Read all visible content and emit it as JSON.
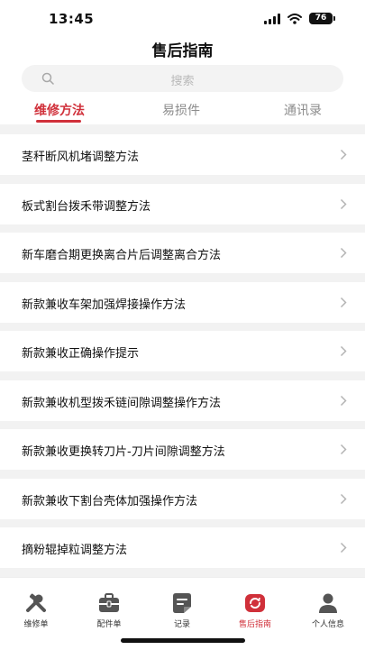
{
  "status": {
    "time": "13:45",
    "battery": "76"
  },
  "page_title": "售后指南",
  "search": {
    "placeholder": "搜索"
  },
  "tabs": [
    {
      "label": "维修方法",
      "active": true
    },
    {
      "label": "易损件",
      "active": false
    },
    {
      "label": "通讯录",
      "active": false
    }
  ],
  "items": [
    {
      "label": "茎秆断风机堵调整方法"
    },
    {
      "label": "板式割台拨禾带调整方法"
    },
    {
      "label": "新车磨合期更换离合片后调整离合方法"
    },
    {
      "label": "新款兼收车架加强焊接操作方法"
    },
    {
      "label": "新款兼收正确操作提示"
    },
    {
      "label": "新款兼收机型拨禾链间隙调整操作方法"
    },
    {
      "label": "新款兼收更换转刀片-刀片间隙调整方法"
    },
    {
      "label": "新款兼收下割台壳体加强操作方法"
    },
    {
      "label": "摘粉辊掉粒调整方法"
    }
  ],
  "tab_bar": [
    {
      "label": "维修单",
      "icon": "tools-icon"
    },
    {
      "label": "配件单",
      "icon": "toolbox-icon"
    },
    {
      "label": "记录",
      "icon": "notes-icon"
    },
    {
      "label": "售后指南",
      "icon": "guide-icon",
      "active": true
    },
    {
      "label": "个人信息",
      "icon": "person-icon"
    }
  ],
  "colors": {
    "accent": "#d0303a",
    "background": "#f2f2f2"
  }
}
